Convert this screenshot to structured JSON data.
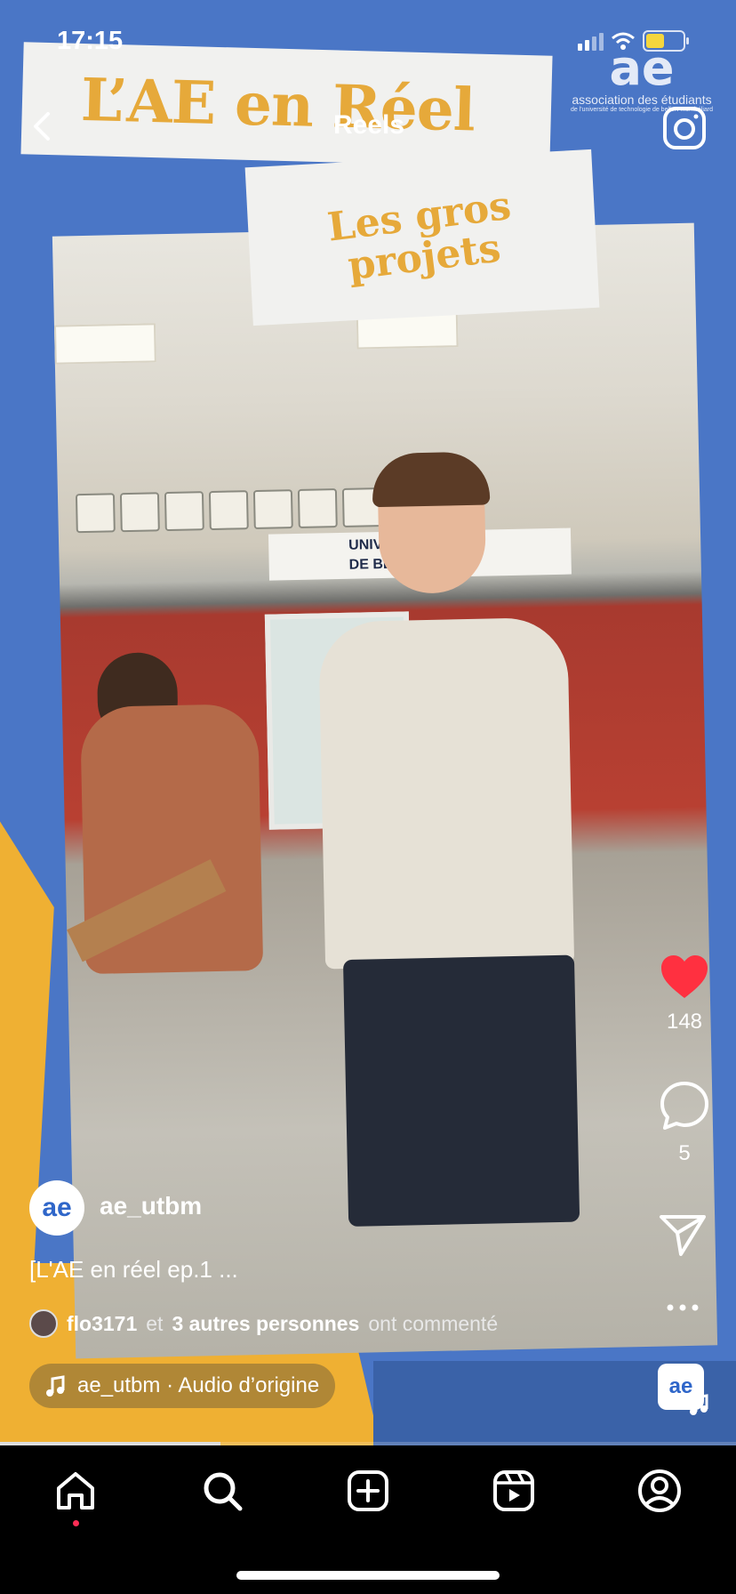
{
  "status_bar": {
    "time": "17:15"
  },
  "header": {
    "title": "Reels"
  },
  "overlay": {
    "title_card": "L’AE en Réel",
    "subtitle_card_line1": "Les gros",
    "subtitle_card_line2": "projets",
    "logo_mark": "ae",
    "logo_text": "association des étudiants",
    "logo_subtext": "de l'université de technologie de belfort-montbéliard",
    "sign_text_1": "UNIVERSITÉ",
    "sign_text_2": "DE BELFORT"
  },
  "actions": {
    "likes": "148",
    "comments": "5"
  },
  "post": {
    "avatar_mark": "ae",
    "username": "ae_utbm",
    "caption": "[L'AE en réel ep.1 ...",
    "commenter": "flo3171",
    "comments_middle": "et",
    "comments_others": "3 autres personnes",
    "comments_suffix": "ont commenté",
    "audio": "ae_utbm · Audio d’origine",
    "audio_thumb": "ae"
  },
  "playback": {
    "progress_fraction": 0.3
  },
  "colors": {
    "like_red": "#ff3040",
    "accent_yellow": "#e6a93a",
    "background_blue": "#4a76c6"
  },
  "tabs": [
    {
      "name": "home",
      "icon": "home-icon"
    },
    {
      "name": "search",
      "icon": "search-icon"
    },
    {
      "name": "create",
      "icon": "plus-square-icon"
    },
    {
      "name": "reels",
      "icon": "reels-icon"
    },
    {
      "name": "profile",
      "icon": "profile-icon"
    }
  ]
}
